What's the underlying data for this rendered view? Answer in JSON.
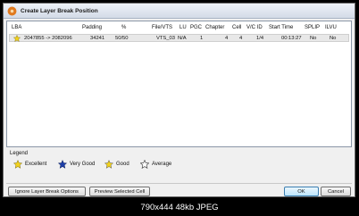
{
  "window": {
    "title": "Create Layer Break Position"
  },
  "columns": [
    "LBA",
    "Padding",
    "%",
    "File/VTS",
    "LU",
    "PGC",
    "Chapter",
    "Cell",
    "V/C ID",
    "Start Time",
    "SPLIP",
    "ILVU"
  ],
  "rows": [
    {
      "rating": "excellent",
      "lba": "2047855 -> 2082096",
      "padding": "34241",
      "percent": "50/50",
      "file_vts": "VTS_03",
      "lu": "N/A",
      "pgc": "1",
      "chapter": "4",
      "cell": "4",
      "vc_id": "1/4",
      "start_time": "00:13:27",
      "splip": "No",
      "ilvu": "No"
    }
  ],
  "legend": {
    "title": "Legend",
    "items": [
      {
        "label": "Excellent",
        "color": "#f2d21c"
      },
      {
        "label": "Very Good",
        "color": "#1e3fa8"
      },
      {
        "label": "Good",
        "color": "#f2d21c"
      },
      {
        "label": "Average",
        "color": "#ffffff"
      }
    ]
  },
  "buttons": {
    "ignore": "Ignore Layer Break Options",
    "preview": "Preview Selected Cell",
    "ok": "OK",
    "cancel": "Cancel"
  },
  "footer": {
    "text": "790x444  48kb  JPEG"
  }
}
